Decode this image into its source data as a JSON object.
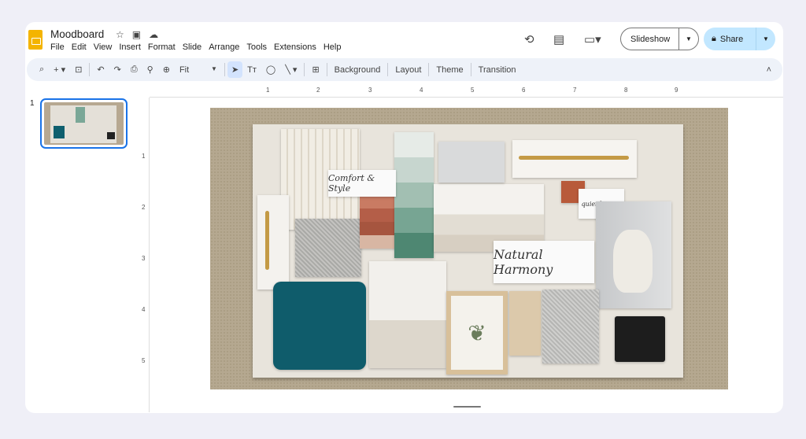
{
  "app": {
    "title": "Moodboard",
    "title_icons": [
      "star-icon",
      "move-to-folder-icon",
      "cloud-saved-icon"
    ]
  },
  "menu": [
    "File",
    "Edit",
    "View",
    "Insert",
    "Format",
    "Slide",
    "Arrange",
    "Tools",
    "Extensions",
    "Help"
  ],
  "header": {
    "slideshow_label": "Slideshow",
    "share_label": "Share"
  },
  "toolbar": {
    "zoom": "Fit",
    "background": "Background",
    "layout": "Layout",
    "theme": "Theme",
    "transition": "Transition"
  },
  "ruler": {
    "horizontal": [
      "1",
      "2",
      "3",
      "4",
      "5",
      "6",
      "7",
      "8",
      "9"
    ],
    "vertical": [
      "1",
      "2",
      "3",
      "4",
      "5"
    ]
  },
  "slides": [
    {
      "number": "1"
    }
  ],
  "slide": {
    "labels": {
      "comfort": "Comfort & Style",
      "harmony": "Natural Harmony",
      "note": "quiet lounge"
    }
  },
  "colors": {
    "accent": "#1a73e8",
    "share_bg": "#c2e7ff",
    "logo": "#f4b400"
  }
}
